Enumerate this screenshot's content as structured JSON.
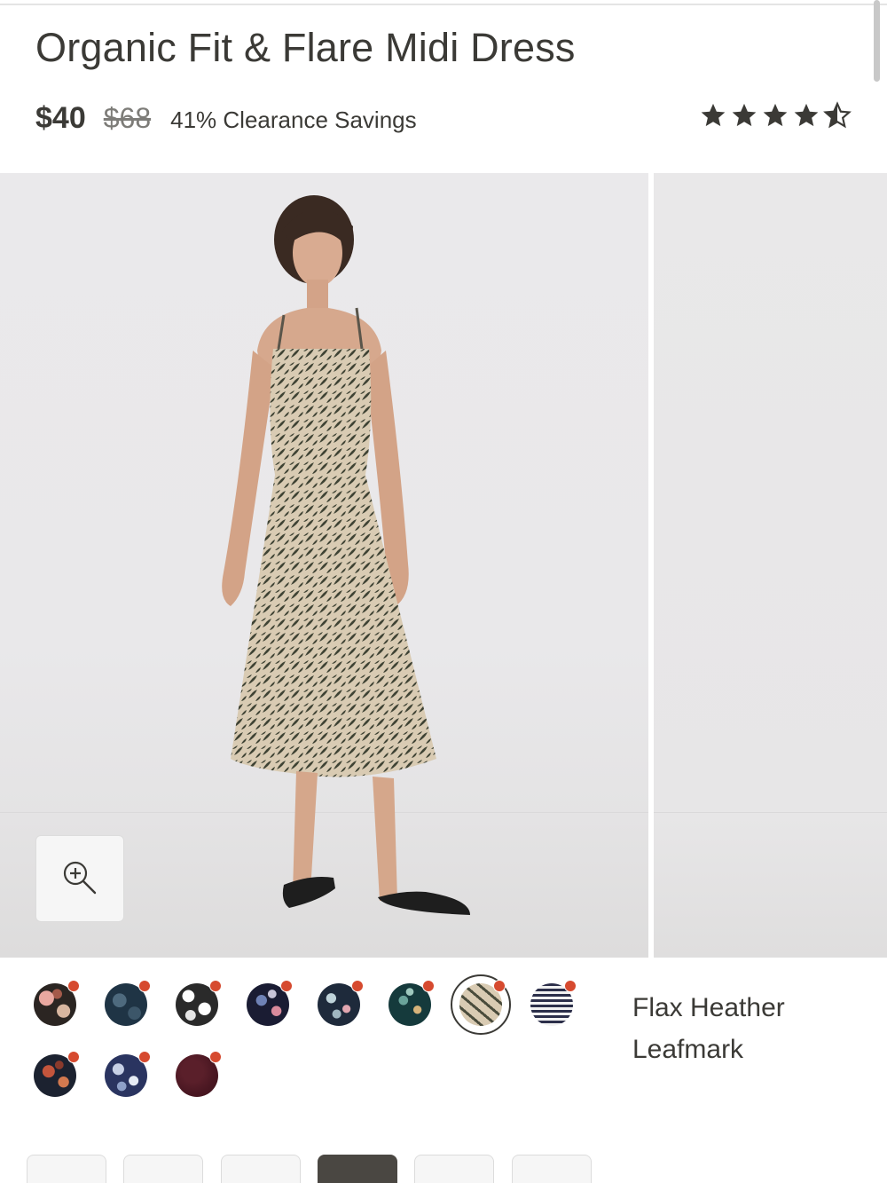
{
  "product": {
    "title": "Organic Fit & Flare Midi Dress",
    "price_now": "$40",
    "price_was": "$68",
    "savings": "41% Clearance Savings",
    "rating_stars": 4.5
  },
  "gallery": {
    "zoom_icon": "zoom-in-icon"
  },
  "color_selector": {
    "selected_name": "Flax Heather Leafmark",
    "selected_index": 6,
    "swatch_count": 11,
    "sale_dot_color": "#d64a2f"
  },
  "size_selector": {
    "selected_index": 3,
    "visible_count": 6
  },
  "colors": {
    "text": "#3b3a36",
    "strike": "#7d7c78",
    "sale_dot": "#d64a2f"
  }
}
